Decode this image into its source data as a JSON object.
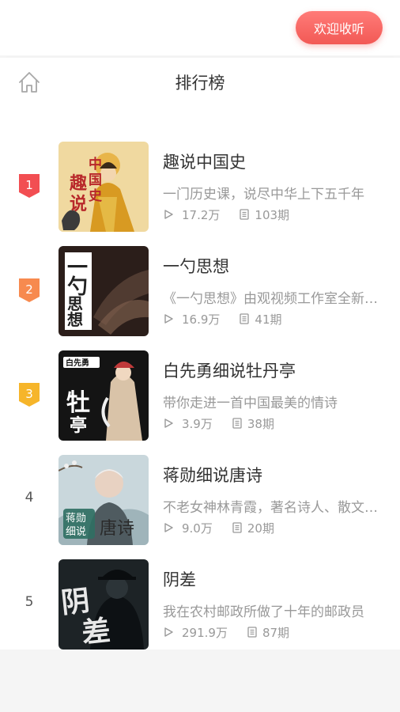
{
  "welcome_label": "欢迎收听",
  "page_title": "排行榜",
  "icons": {
    "home": "home-icon",
    "play": "play-icon",
    "episodes": "list-icon"
  },
  "colors": {
    "rank1": "#f24e52",
    "rank2": "#f78a4f",
    "rank3": "#f6b52a",
    "accent": "#f25955"
  },
  "items": [
    {
      "rank": "1",
      "title": "趣说中国史",
      "desc": "一门历史课，说尽中华上下五千年",
      "plays": "17.2万",
      "episodes": "103期",
      "cover_text": "趣说 中国史"
    },
    {
      "rank": "2",
      "title": "一勺思想",
      "desc": "《一勺思想》由观视频工作室全新打造",
      "plays": "16.9万",
      "episodes": "41期",
      "cover_text": "一勺思想"
    },
    {
      "rank": "3",
      "title": "白先勇细说牡丹亭",
      "desc": "带你走进一首中国最美的情诗",
      "plays": "3.9万",
      "episodes": "38期",
      "cover_text": "牡丹亭"
    },
    {
      "rank": "4",
      "title": "蒋勋细说唐诗",
      "desc": "不老女神林青霞，著名诗人、散文家推荐",
      "plays": "9.0万",
      "episodes": "20期",
      "cover_text": "蒋勋 细说 唐诗"
    },
    {
      "rank": "5",
      "title": "阴差",
      "desc": "我在农村邮政所做了十年的邮政员",
      "plays": "291.9万",
      "episodes": "87期",
      "cover_text": "阴差"
    }
  ]
}
